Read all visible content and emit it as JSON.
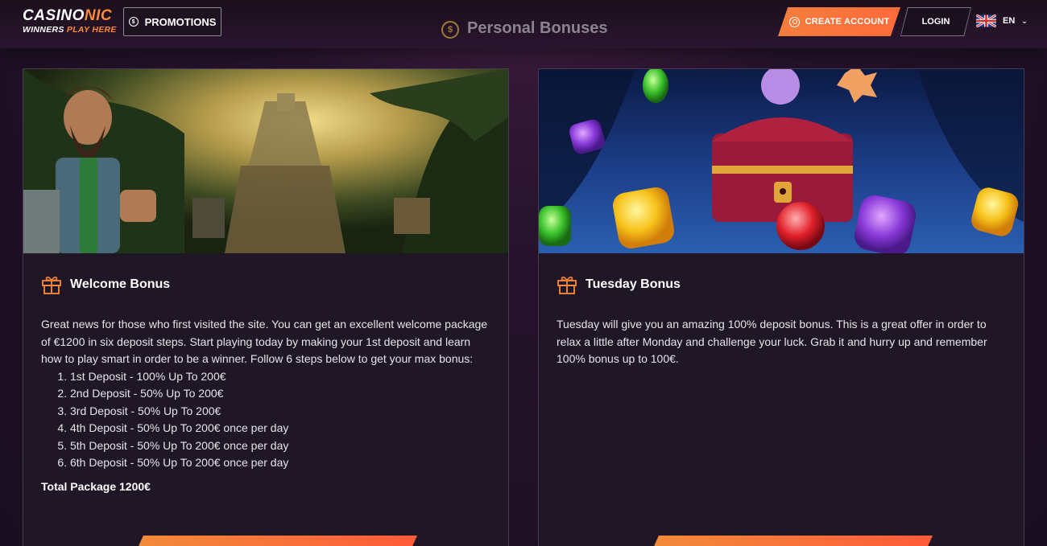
{
  "header": {
    "logo_main_a": "CASINO",
    "logo_main_b": "NIC",
    "logo_sub_a": "WINNERS ",
    "logo_sub_b": "PLAY HERE",
    "promotions_label": "PROMOTIONS",
    "page_title": "Personal Bonuses",
    "create_account_label": "CREATE ACCOUNT",
    "login_label": "LOGIN",
    "language": "EN"
  },
  "cards": [
    {
      "title": "Welcome Bonus",
      "intro": "Great news for those who first visited the site. You can get an excellent welcome package of €1200 in six deposit steps. Start playing today by making your 1st deposit and learn how to play smart in order to be a winner. Follow 6 steps below to get your max bonus:",
      "steps": [
        "1st Deposit - 100% Up To 200€",
        "2nd Deposit - 50% Up To 200€",
        "3rd Deposit - 50% Up To 200€",
        "4th Deposit - 50% Up To 200€ once per day",
        "5th Deposit - 50% Up To 200€ once per day",
        "6th Deposit - 50% Up To 200€ once per day"
      ],
      "total": "Total Package 1200€"
    },
    {
      "title": "Tuesday Bonus",
      "intro": "Tuesday will give you an amazing 100% deposit bonus. This is a great offer in order to relax a little after Monday and challenge your luck. Grab it and hurry up and remember 100% bonus up to 100€."
    }
  ],
  "colors": {
    "accent": "#ff7a3a",
    "background": "#1f1224",
    "card": "#201726"
  },
  "icons": {
    "promotions": "coin-icon",
    "title": "coin-icon",
    "create_account": "user-icon",
    "language": "uk-flag-icon",
    "card_heading": "gift-icon"
  }
}
